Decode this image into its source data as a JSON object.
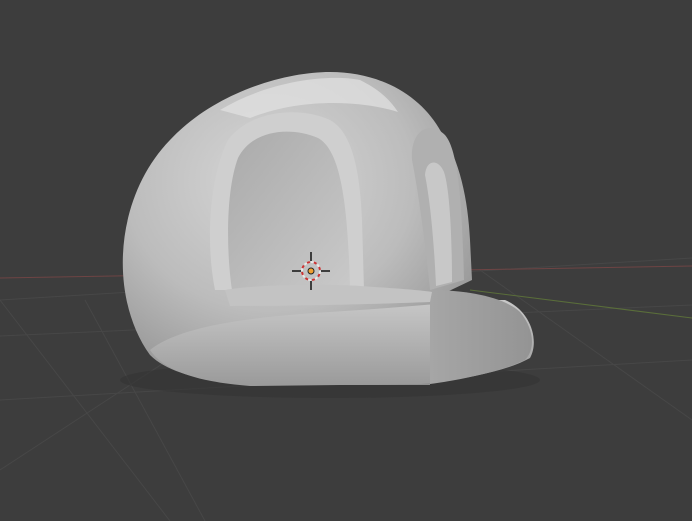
{
  "app": "Blender",
  "viewport": {
    "mode": "3d-viewport",
    "shading": "solid",
    "background_color": "#3d3d3d",
    "grid_line_color": "#4a4a4a",
    "x_axis_color": "#7a4a4a",
    "y_axis_color": "#5f7a3a"
  },
  "scene": {
    "object": {
      "kind": "sculpted-mesh",
      "shape": "hood-arch",
      "base_color": "#b9b9b9",
      "highlight_color": "#d9d9d9",
      "shadow_color": "#8a8a8a",
      "selected": false
    },
    "cursor_3d": {
      "icon": "3d-cursor-icon",
      "ring_colors": [
        "#e8e8e8",
        "#cc3333"
      ]
    },
    "origin_point": {
      "icon": "object-origin-icon",
      "color": "#f0a030"
    }
  }
}
